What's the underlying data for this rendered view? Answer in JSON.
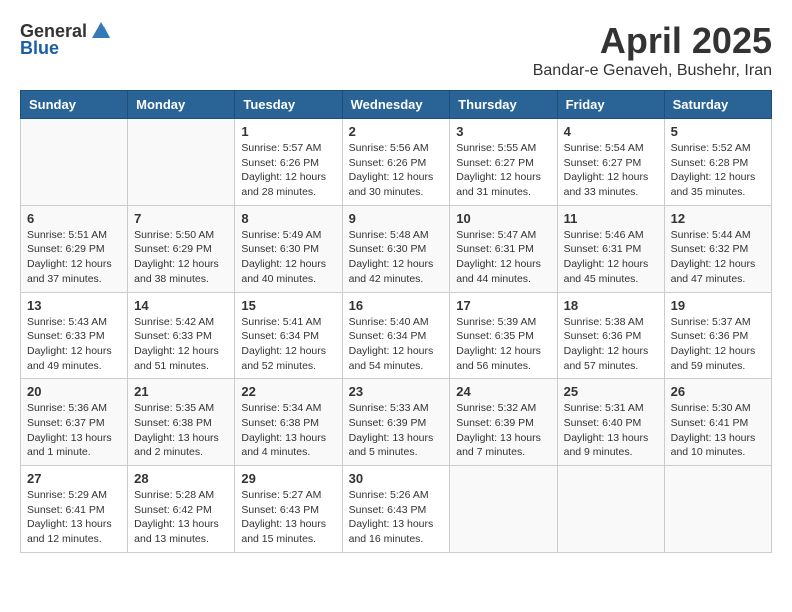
{
  "header": {
    "logo_general": "General",
    "logo_blue": "Blue",
    "month": "April 2025",
    "location": "Bandar-e Genaveh, Bushehr, Iran"
  },
  "days_of_week": [
    "Sunday",
    "Monday",
    "Tuesday",
    "Wednesday",
    "Thursday",
    "Friday",
    "Saturday"
  ],
  "weeks": [
    [
      {
        "day": "",
        "sunrise": "",
        "sunset": "",
        "daylight": ""
      },
      {
        "day": "",
        "sunrise": "",
        "sunset": "",
        "daylight": ""
      },
      {
        "day": "1",
        "sunrise": "Sunrise: 5:57 AM",
        "sunset": "Sunset: 6:26 PM",
        "daylight": "Daylight: 12 hours and 28 minutes."
      },
      {
        "day": "2",
        "sunrise": "Sunrise: 5:56 AM",
        "sunset": "Sunset: 6:26 PM",
        "daylight": "Daylight: 12 hours and 30 minutes."
      },
      {
        "day": "3",
        "sunrise": "Sunrise: 5:55 AM",
        "sunset": "Sunset: 6:27 PM",
        "daylight": "Daylight: 12 hours and 31 minutes."
      },
      {
        "day": "4",
        "sunrise": "Sunrise: 5:54 AM",
        "sunset": "Sunset: 6:27 PM",
        "daylight": "Daylight: 12 hours and 33 minutes."
      },
      {
        "day": "5",
        "sunrise": "Sunrise: 5:52 AM",
        "sunset": "Sunset: 6:28 PM",
        "daylight": "Daylight: 12 hours and 35 minutes."
      }
    ],
    [
      {
        "day": "6",
        "sunrise": "Sunrise: 5:51 AM",
        "sunset": "Sunset: 6:29 PM",
        "daylight": "Daylight: 12 hours and 37 minutes."
      },
      {
        "day": "7",
        "sunrise": "Sunrise: 5:50 AM",
        "sunset": "Sunset: 6:29 PM",
        "daylight": "Daylight: 12 hours and 38 minutes."
      },
      {
        "day": "8",
        "sunrise": "Sunrise: 5:49 AM",
        "sunset": "Sunset: 6:30 PM",
        "daylight": "Daylight: 12 hours and 40 minutes."
      },
      {
        "day": "9",
        "sunrise": "Sunrise: 5:48 AM",
        "sunset": "Sunset: 6:30 PM",
        "daylight": "Daylight: 12 hours and 42 minutes."
      },
      {
        "day": "10",
        "sunrise": "Sunrise: 5:47 AM",
        "sunset": "Sunset: 6:31 PM",
        "daylight": "Daylight: 12 hours and 44 minutes."
      },
      {
        "day": "11",
        "sunrise": "Sunrise: 5:46 AM",
        "sunset": "Sunset: 6:31 PM",
        "daylight": "Daylight: 12 hours and 45 minutes."
      },
      {
        "day": "12",
        "sunrise": "Sunrise: 5:44 AM",
        "sunset": "Sunset: 6:32 PM",
        "daylight": "Daylight: 12 hours and 47 minutes."
      }
    ],
    [
      {
        "day": "13",
        "sunrise": "Sunrise: 5:43 AM",
        "sunset": "Sunset: 6:33 PM",
        "daylight": "Daylight: 12 hours and 49 minutes."
      },
      {
        "day": "14",
        "sunrise": "Sunrise: 5:42 AM",
        "sunset": "Sunset: 6:33 PM",
        "daylight": "Daylight: 12 hours and 51 minutes."
      },
      {
        "day": "15",
        "sunrise": "Sunrise: 5:41 AM",
        "sunset": "Sunset: 6:34 PM",
        "daylight": "Daylight: 12 hours and 52 minutes."
      },
      {
        "day": "16",
        "sunrise": "Sunrise: 5:40 AM",
        "sunset": "Sunset: 6:34 PM",
        "daylight": "Daylight: 12 hours and 54 minutes."
      },
      {
        "day": "17",
        "sunrise": "Sunrise: 5:39 AM",
        "sunset": "Sunset: 6:35 PM",
        "daylight": "Daylight: 12 hours and 56 minutes."
      },
      {
        "day": "18",
        "sunrise": "Sunrise: 5:38 AM",
        "sunset": "Sunset: 6:36 PM",
        "daylight": "Daylight: 12 hours and 57 minutes."
      },
      {
        "day": "19",
        "sunrise": "Sunrise: 5:37 AM",
        "sunset": "Sunset: 6:36 PM",
        "daylight": "Daylight: 12 hours and 59 minutes."
      }
    ],
    [
      {
        "day": "20",
        "sunrise": "Sunrise: 5:36 AM",
        "sunset": "Sunset: 6:37 PM",
        "daylight": "Daylight: 13 hours and 1 minute."
      },
      {
        "day": "21",
        "sunrise": "Sunrise: 5:35 AM",
        "sunset": "Sunset: 6:38 PM",
        "daylight": "Daylight: 13 hours and 2 minutes."
      },
      {
        "day": "22",
        "sunrise": "Sunrise: 5:34 AM",
        "sunset": "Sunset: 6:38 PM",
        "daylight": "Daylight: 13 hours and 4 minutes."
      },
      {
        "day": "23",
        "sunrise": "Sunrise: 5:33 AM",
        "sunset": "Sunset: 6:39 PM",
        "daylight": "Daylight: 13 hours and 5 minutes."
      },
      {
        "day": "24",
        "sunrise": "Sunrise: 5:32 AM",
        "sunset": "Sunset: 6:39 PM",
        "daylight": "Daylight: 13 hours and 7 minutes."
      },
      {
        "day": "25",
        "sunrise": "Sunrise: 5:31 AM",
        "sunset": "Sunset: 6:40 PM",
        "daylight": "Daylight: 13 hours and 9 minutes."
      },
      {
        "day": "26",
        "sunrise": "Sunrise: 5:30 AM",
        "sunset": "Sunset: 6:41 PM",
        "daylight": "Daylight: 13 hours and 10 minutes."
      }
    ],
    [
      {
        "day": "27",
        "sunrise": "Sunrise: 5:29 AM",
        "sunset": "Sunset: 6:41 PM",
        "daylight": "Daylight: 13 hours and 12 minutes."
      },
      {
        "day": "28",
        "sunrise": "Sunrise: 5:28 AM",
        "sunset": "Sunset: 6:42 PM",
        "daylight": "Daylight: 13 hours and 13 minutes."
      },
      {
        "day": "29",
        "sunrise": "Sunrise: 5:27 AM",
        "sunset": "Sunset: 6:43 PM",
        "daylight": "Daylight: 13 hours and 15 minutes."
      },
      {
        "day": "30",
        "sunrise": "Sunrise: 5:26 AM",
        "sunset": "Sunset: 6:43 PM",
        "daylight": "Daylight: 13 hours and 16 minutes."
      },
      {
        "day": "",
        "sunrise": "",
        "sunset": "",
        "daylight": ""
      },
      {
        "day": "",
        "sunrise": "",
        "sunset": "",
        "daylight": ""
      },
      {
        "day": "",
        "sunrise": "",
        "sunset": "",
        "daylight": ""
      }
    ]
  ]
}
